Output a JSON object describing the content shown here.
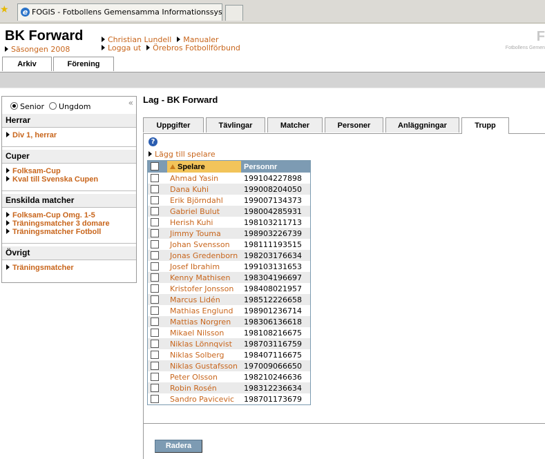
{
  "browser": {
    "tab_title": "FOGIS - Fotbollens Gemensamma Informationssystem"
  },
  "header": {
    "club_name": "BK Forward",
    "season": "Säsongen 2008",
    "user_link": "Christian Lundell",
    "manual_link": "Manualer",
    "logout_link": "Logga ut",
    "association_link": "Örebros Fotbollförbund",
    "logo_letter": "F",
    "logo_subtitle": "Fotbollens Gemen",
    "nav": [
      "Arkiv",
      "Förening"
    ]
  },
  "sidebar": {
    "radio_senior": "Senior",
    "radio_ungdom": "Ungdom",
    "selected": "Senior",
    "collapse_icon": "double-chevron-left-icon",
    "sections": [
      {
        "title": "Herrar",
        "items": [
          "Div 1, herrar"
        ]
      },
      {
        "title": "Cuper",
        "items": [
          "Folksam-Cup",
          "Kval till Svenska Cupen"
        ]
      },
      {
        "title": "Enskilda matcher",
        "items": [
          "Folksam-Cup Omg. 1-5",
          "Träningsmatcher 3 domare",
          "Träningsmatcher Fotboll"
        ]
      },
      {
        "title": "Övrigt",
        "items": [
          "Träningsmatcher"
        ]
      }
    ]
  },
  "main": {
    "title": "Lag - BK Forward",
    "tabs": [
      "Uppgifter",
      "Tävlingar",
      "Matcher",
      "Personer",
      "Anläggningar",
      "Trupp"
    ],
    "active_tab": "Trupp",
    "add_player": "Lägg till spelare",
    "columns": [
      "Spelare",
      "Personnr"
    ],
    "players": [
      {
        "name": "Ahmad Yasin",
        "pnr": "199104227898"
      },
      {
        "name": "Dana Kuhi",
        "pnr": "199008204050"
      },
      {
        "name": "Erik Björndahl",
        "pnr": "199007134373"
      },
      {
        "name": "Gabriel Bulut",
        "pnr": "198004285931"
      },
      {
        "name": "Herish Kuhi",
        "pnr": "198103211713"
      },
      {
        "name": "Jimmy Touma",
        "pnr": "198903226739"
      },
      {
        "name": "Johan Svensson",
        "pnr": "198111193515"
      },
      {
        "name": "Jonas Gredenborn",
        "pnr": "198203176634"
      },
      {
        "name": "Josef Ibrahim",
        "pnr": "199103131653"
      },
      {
        "name": "Kenny Mathisen",
        "pnr": "198304196697"
      },
      {
        "name": "Kristofer Jonsson",
        "pnr": "198408021957"
      },
      {
        "name": "Marcus Lidén",
        "pnr": "198512226658"
      },
      {
        "name": "Mathias Englund",
        "pnr": "198901236714"
      },
      {
        "name": "Mattias Norgren",
        "pnr": "198306136618"
      },
      {
        "name": "Mikael Nilsson",
        "pnr": "198108216675"
      },
      {
        "name": "Niklas Lönnqvist",
        "pnr": "198703116759"
      },
      {
        "name": "Niklas Solberg",
        "pnr": "198407116675"
      },
      {
        "name": "Niklas Gustafsson",
        "pnr": "197009066650"
      },
      {
        "name": "Peter Olsson",
        "pnr": "198210246636"
      },
      {
        "name": "Robin Rosén",
        "pnr": "198312236634"
      },
      {
        "name": "Sandro Pavicevic",
        "pnr": "198701173679"
      }
    ],
    "delete_button": "Radera"
  },
  "colors": {
    "link": "#c8651b",
    "table_header": "#7d9bb3",
    "sorted_header": "#f2c45a"
  }
}
